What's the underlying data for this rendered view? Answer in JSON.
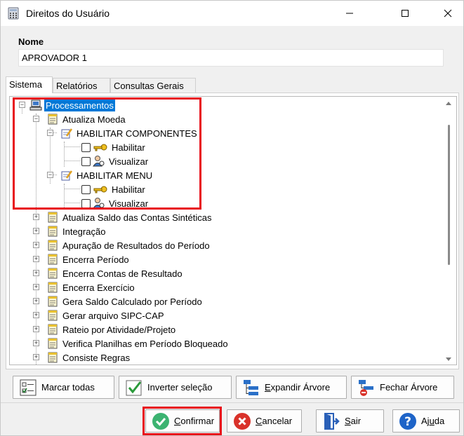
{
  "window": {
    "title": "Direitos do Usuário"
  },
  "form": {
    "nome_label": "Nome",
    "nome_value": "APROVADOR 1"
  },
  "tabs": [
    {
      "label": "Sistema",
      "active": true
    },
    {
      "label": "Relatórios",
      "active": false
    },
    {
      "label": "Consultas Gerais",
      "active": false
    }
  ],
  "tree": {
    "root": "Processamentos",
    "atualiza_moeda": "Atualiza Moeda",
    "habilitar_componentes": "HABILITAR COMPONENTES",
    "habilitar_menu": "HABILITAR MENU",
    "habilitar": "Habilitar",
    "visualizar": "Visualizar",
    "items": [
      "Atualiza Saldo das Contas Sintéticas",
      "Integração",
      "Apuração de Resultados do Período",
      "Encerra Período",
      "Encerra Contas de Resultado",
      "Encerra Exercício",
      "Gera Saldo Calculado por Período",
      "Gerar arquivo SIPC-CAP",
      "Rateio por Atividade/Projeto",
      "Verifica Planilhas em Período Bloqueado",
      "Consiste Regras"
    ]
  },
  "actions": {
    "marcar_todas": "Marcar todas",
    "inverter_selecao": "Inverter seleção",
    "expandir_arvore_pre": "",
    "expandir_arvore_u": "E",
    "expandir_arvore_post": "xpandir Árvore",
    "fechar_arvore": "Fechar Árvore"
  },
  "footer": {
    "confirmar_u": "C",
    "confirmar_rest": "onfirmar",
    "cancelar_u": "C",
    "cancelar_rest": "ancelar",
    "sair_u": "S",
    "sair_rest": "air",
    "ajuda_pre": "Aj",
    "ajuda_u": "u",
    "ajuda_post": "da"
  },
  "colors": {
    "highlight": "#e8101a",
    "selection": "#0078d7",
    "confirm": "#3cb371",
    "cancel": "#d9322a",
    "help": "#1e64c8"
  }
}
